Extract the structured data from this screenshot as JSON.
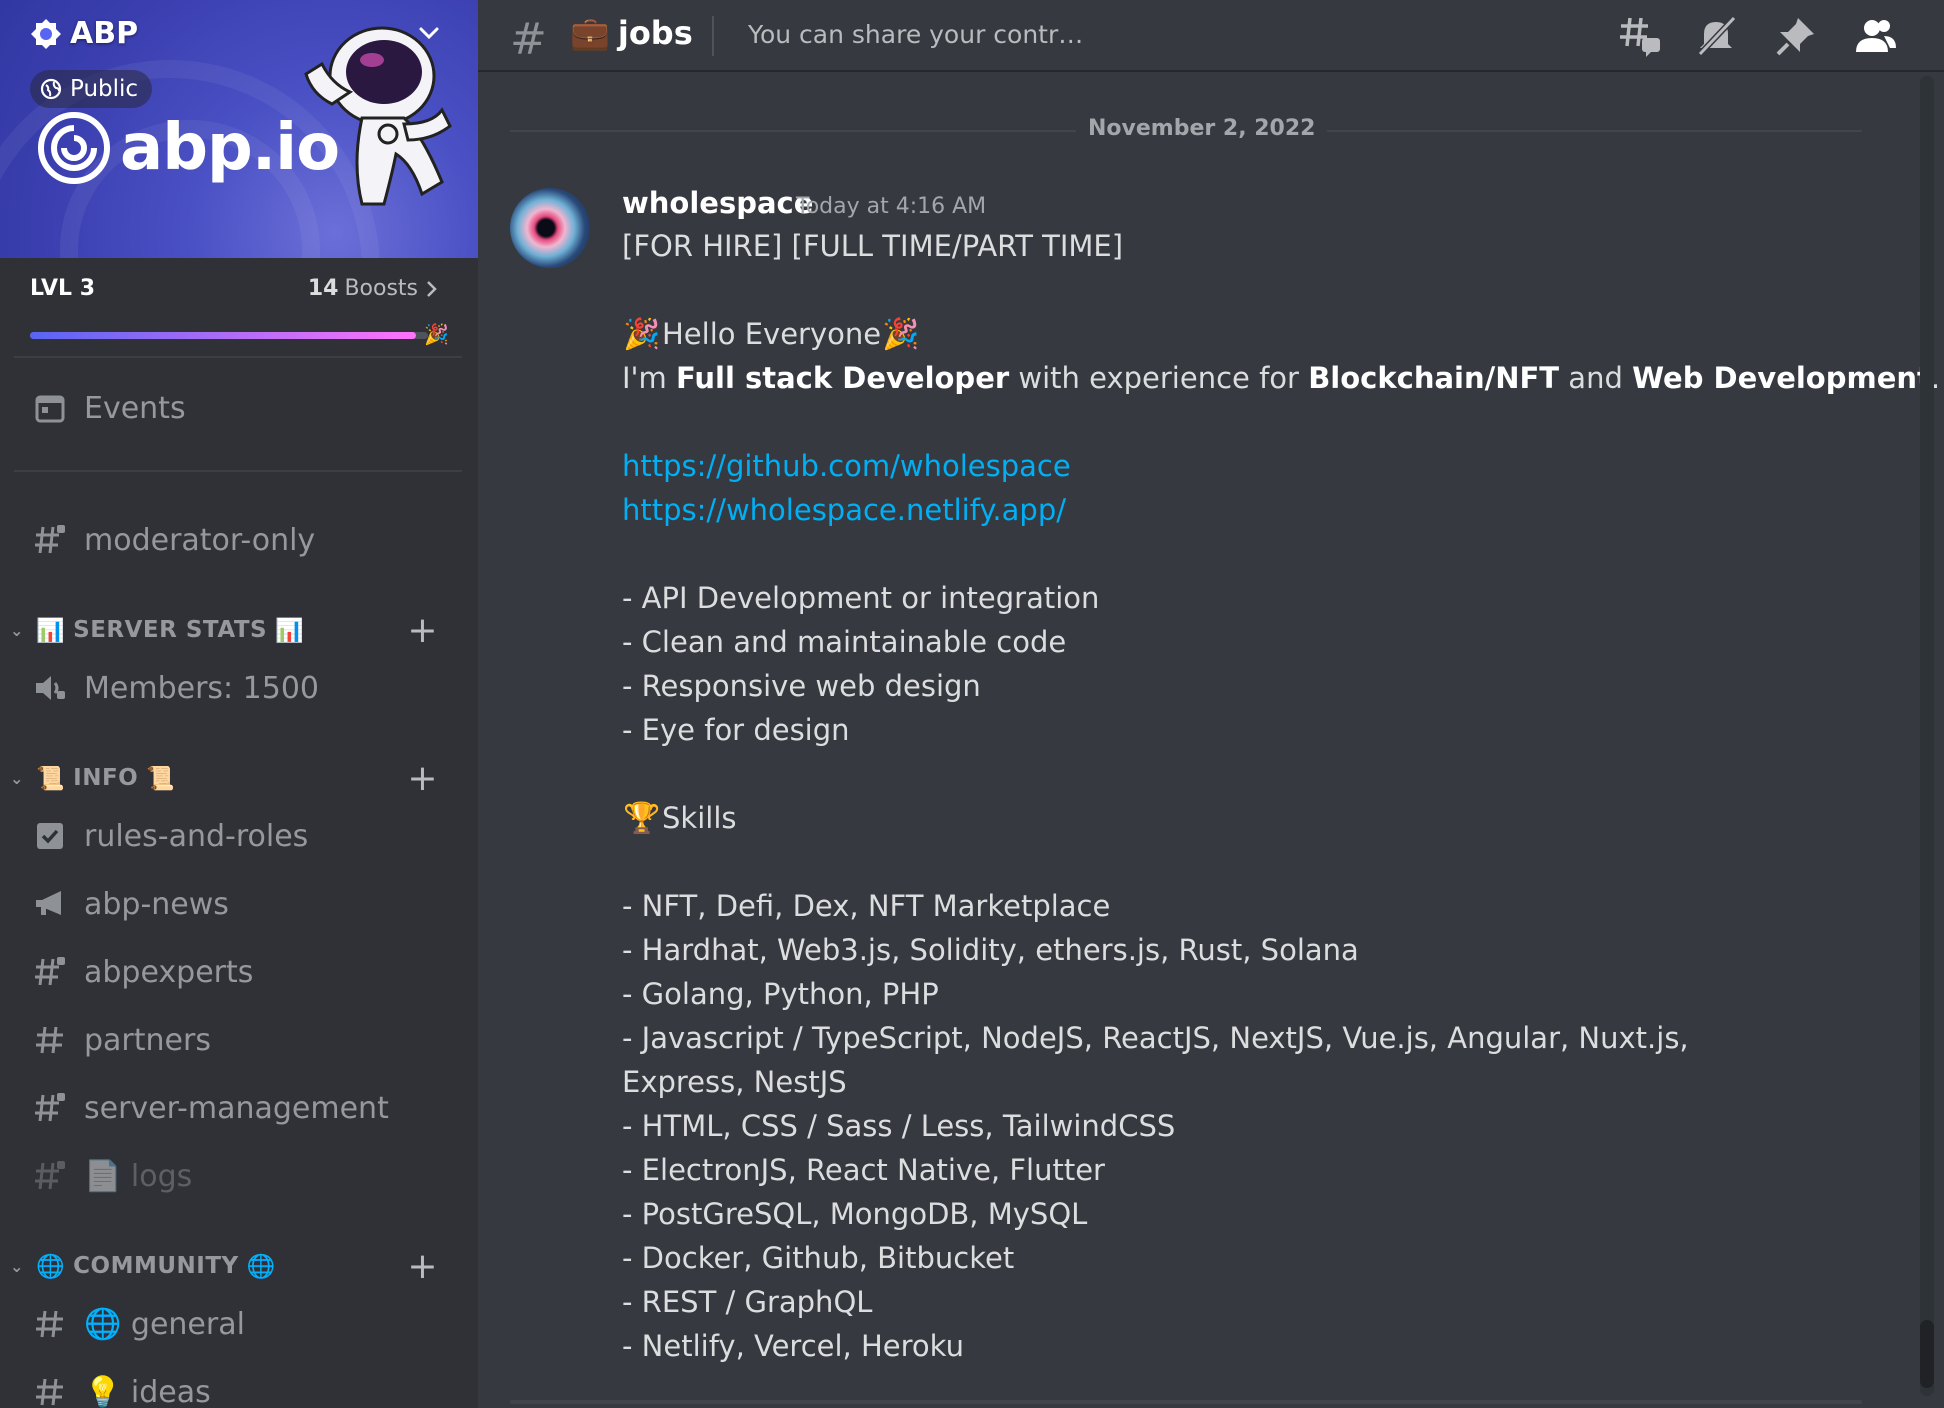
{
  "server": {
    "name": "ABP",
    "visibility": "Public",
    "logo_text": "abp.io",
    "level": "LVL 3",
    "boost_count": "14",
    "boost_label": "Boosts",
    "boost_progress": 0.97
  },
  "sidebar": {
    "events_label": "Events",
    "moderator_channel": "moderator-only",
    "categories": [
      {
        "label": "SERVER STATS",
        "channels": [
          "Members: 1500"
        ]
      },
      {
        "label": "INFO",
        "channels": [
          "rules-and-roles",
          "abp-news",
          "abpexperts",
          "partners",
          "server-management",
          "logs"
        ]
      },
      {
        "label": "COMMUNITY",
        "channels": [
          "general",
          "ideas"
        ]
      }
    ]
  },
  "header": {
    "channel_name": "jobs",
    "topic": "You can share your contract-based work offers and open positions as a..."
  },
  "message": {
    "date_divider": "November 2, 2022",
    "author": "wholespace",
    "timestamp": "Today at 4:16 AM",
    "line1": "[FOR HIRE]  [FULL TIME/PART TIME]",
    "greeting": "Hello Everyone",
    "intro_prefix": "I'm ",
    "intro_role": "Full stack Developer",
    "intro_mid": " with experience for ",
    "intro_field1": "Blockchain/NFT",
    "intro_and": " and ",
    "intro_field2": "Web Development",
    "intro_end": ".",
    "links": [
      "https://github.com/wholespace",
      "https://wholespace.netlify.app/"
    ],
    "services": [
      "- API Development or integration",
      "- Clean and maintainable code",
      "- Responsive web design",
      "- Eye for design"
    ],
    "skills_title": "Skills",
    "skills": [
      "- NFT, Defi, Dex, NFT Marketplace",
      "- Hardhat, Web3.js, Solidity, ethers.js, Rust, Solana",
      "- Golang, Python, PHP",
      "- Javascript / TypeScript, NodeJS, ReactJS, NextJS, Vue.js, Angular, Nuxt.js, Express, NestJS",
      "- HTML, CSS / Sass / Less, TailwindCSS",
      "- ElectronJS, React Native, Flutter",
      "- PostGreSQL, MongoDB, MySQL",
      "- Docker, Github, Bitbucket",
      "- REST / GraphQL",
      "- Netlify, Vercel, Heroku"
    ]
  }
}
